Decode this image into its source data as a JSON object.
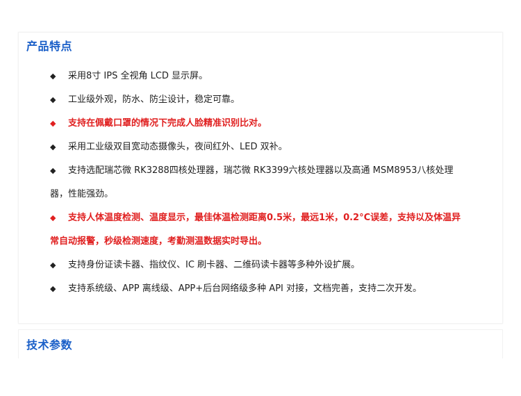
{
  "sections": {
    "features_title": "产品特点",
    "specs_title": "技术参数"
  },
  "features": [
    {
      "text": "采用8寸 IPS 全视角 LCD 显示屏。",
      "highlight": false
    },
    {
      "text": "工业级外观，防水、防尘设计，稳定可靠。",
      "highlight": false
    },
    {
      "text": "支持在佩戴口罩的情况下完成人脸精准识别比对。",
      "highlight": true
    },
    {
      "text": "采用工业级双目宽动态摄像头，夜间红外、LED 双补。",
      "highlight": false
    },
    {
      "text": "支持选配瑞芯微 RK3288四核处理器，瑞芯微 RK3399六核处理器以及高通 MSM8953八核处理",
      "continuation": "器，性能强劲。",
      "highlight": false
    },
    {
      "text": "支持人体温度检测、温度显示，最佳体温检测距离0.5米，最远1米，0.2°C误差，支持以及体温异",
      "continuation": "常自动报警，秒级检测速度，考勤测温数据实时导出。",
      "highlight": true
    },
    {
      "text": "支持身份证读卡器、指纹仪、IC 刷卡器、二维码读卡器等多种外设扩展。",
      "highlight": false
    },
    {
      "text": "支持系统级、APP 离线级、APP+后台网络级多种 API 对接，文档完善，支持二次开发。",
      "highlight": false
    }
  ],
  "bullet_icon": "diamond-bullet-icon",
  "colors": {
    "title": "#1a5fc8",
    "highlight": "#e02020",
    "text": "#222222"
  }
}
